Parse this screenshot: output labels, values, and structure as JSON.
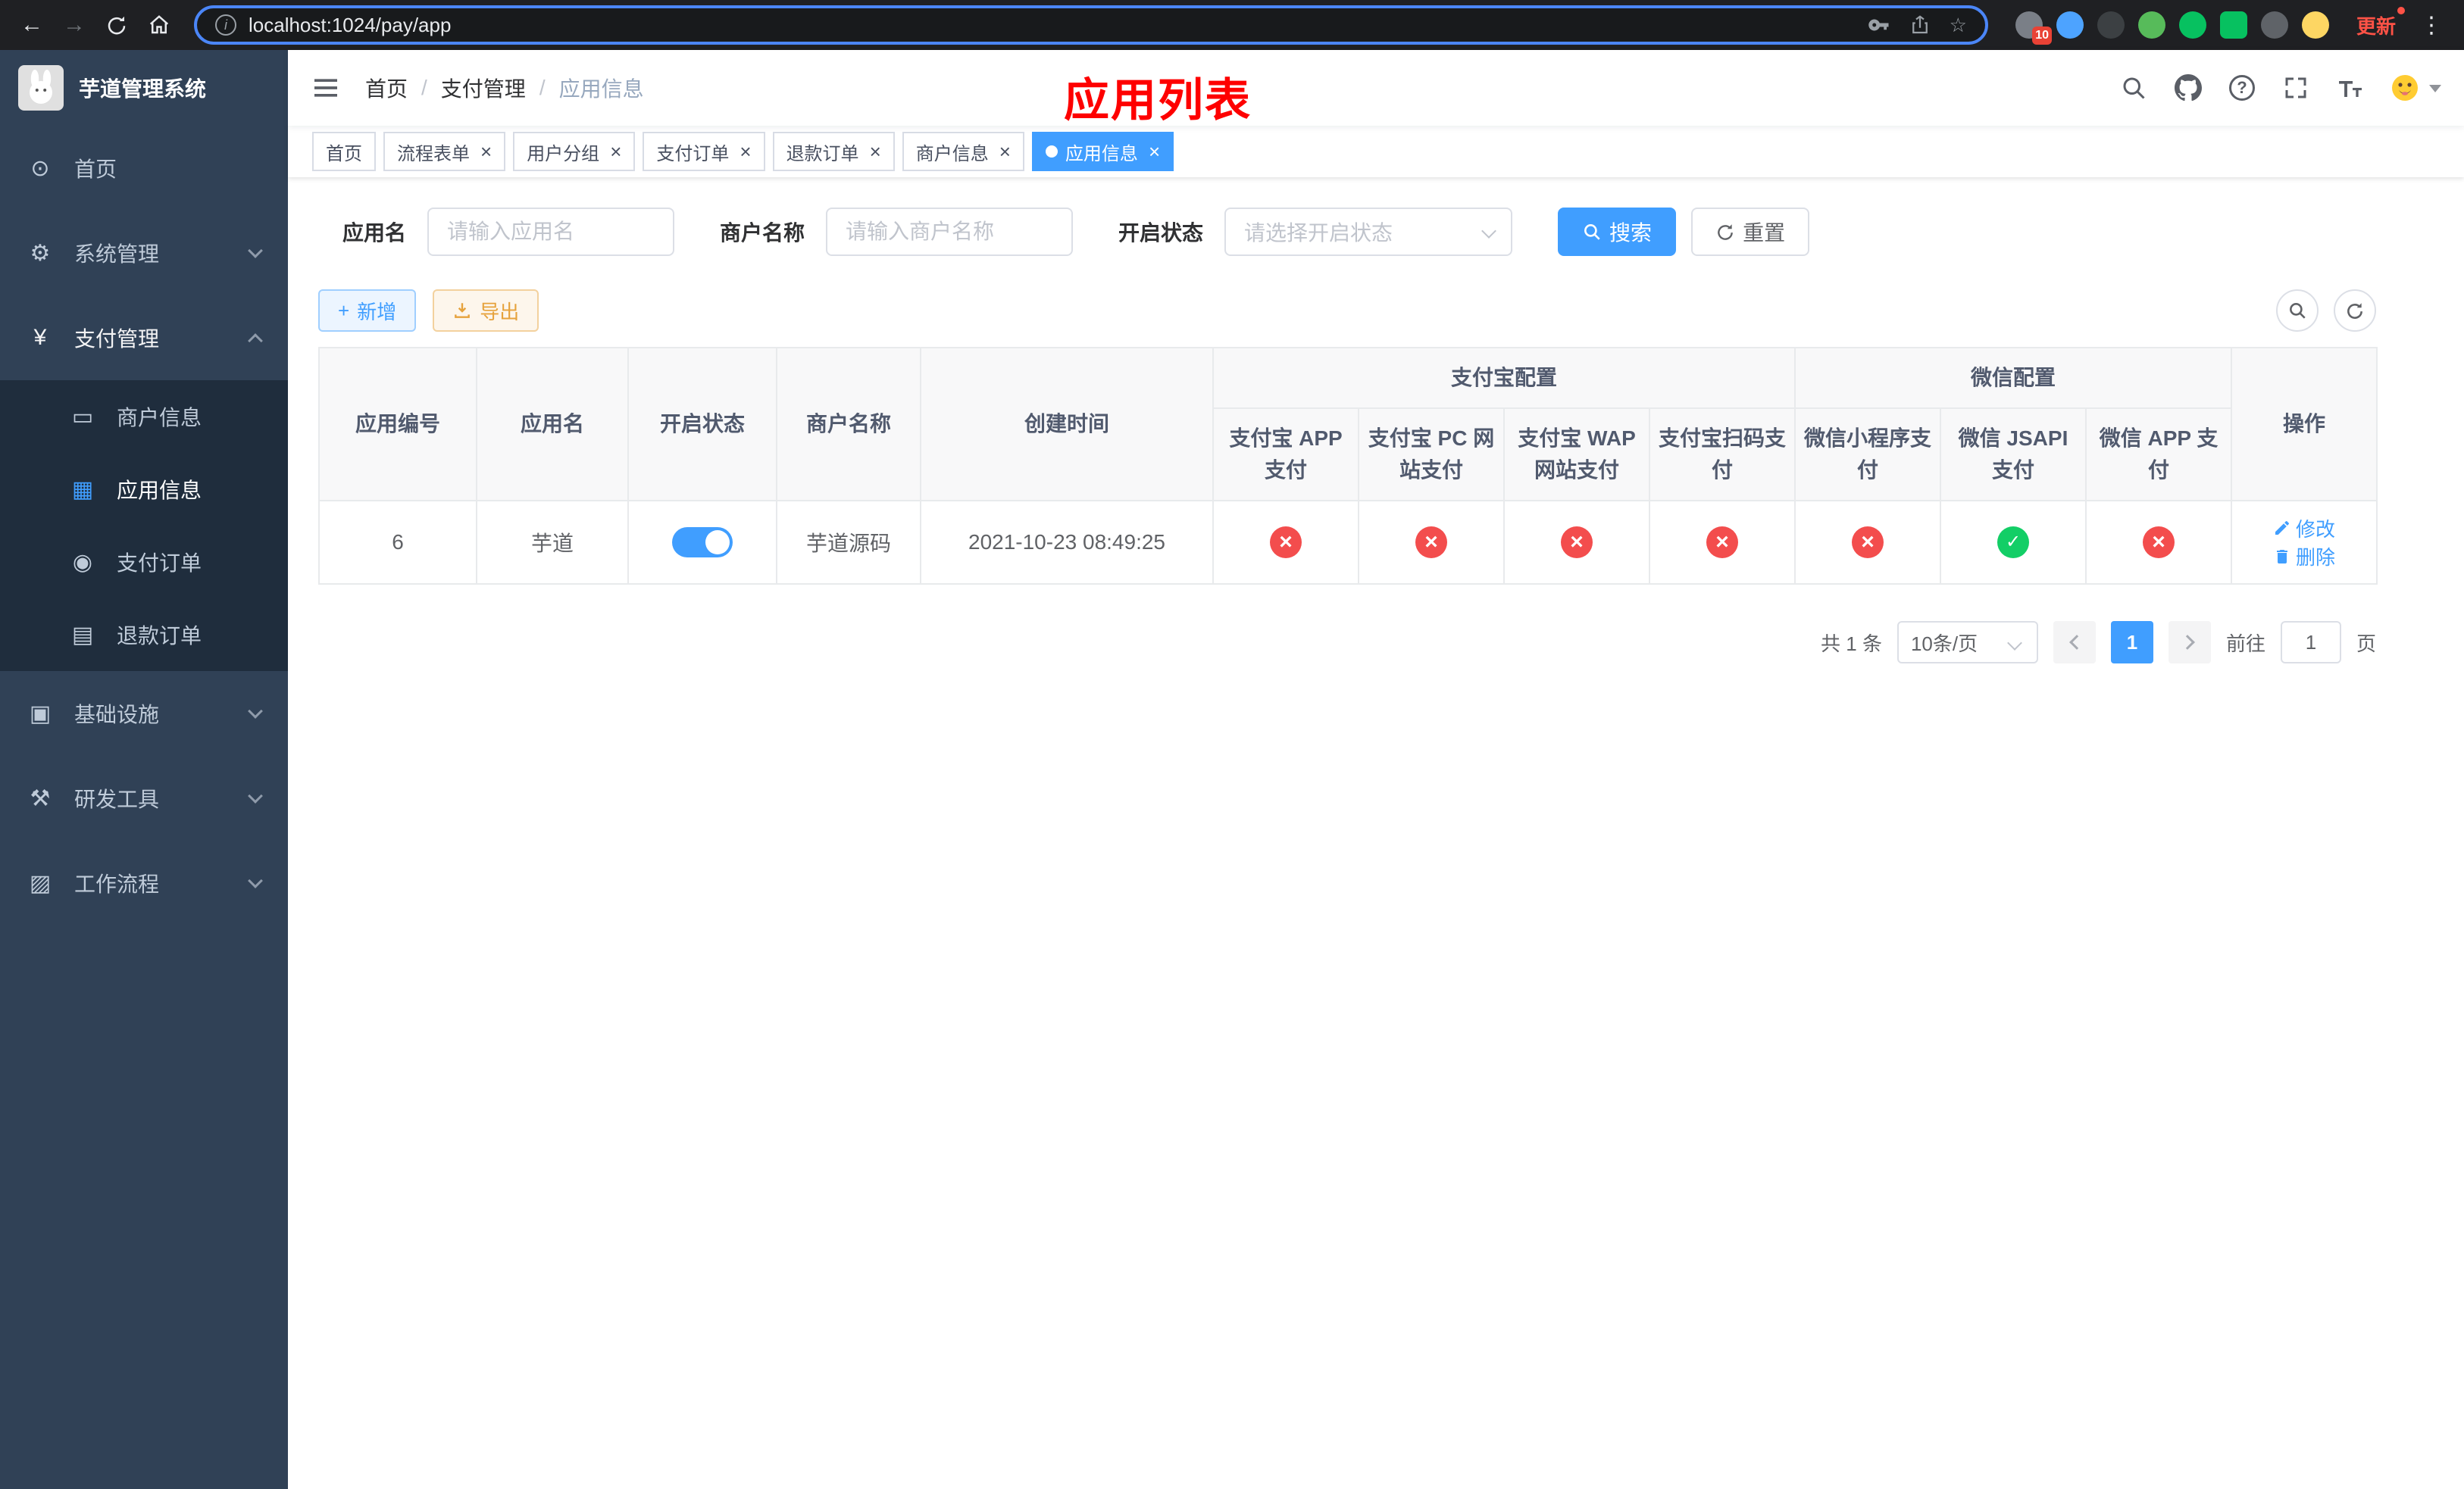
{
  "colors": {
    "primary": "#409eff",
    "success": "#13ce66",
    "danger": "#f34d4d",
    "warning": "#e6a23c",
    "sidebar_bg": "#304156",
    "submenu_bg": "#1f2d3d",
    "annotation": "#fe0000",
    "chrome_bg": "#1f2023",
    "chrome_update": "#ff5246"
  },
  "icons": {
    "back": "←",
    "forward": "→",
    "info": "i",
    "star": "☆",
    "menu_dots": "⋮",
    "close": "×",
    "dashboard": "⊙",
    "gear": "⚙",
    "yen": "¥",
    "merchant": "▭",
    "app": "▦",
    "order": "◉",
    "refund": "▤",
    "infra": "▣",
    "devtool": "⚒",
    "workflow": "▨",
    "plus": "+"
  },
  "browser": {
    "url": "localhost:1024/pay/app",
    "update_label": "更新",
    "extension_badge": "10"
  },
  "sidebar": {
    "logo_title": "芋道管理系统",
    "items": [
      {
        "label": "首页"
      },
      {
        "label": "系统管理"
      },
      {
        "label": "支付管理"
      },
      {
        "label": "基础设施"
      },
      {
        "label": "研发工具"
      },
      {
        "label": "工作流程"
      }
    ],
    "payment_children": [
      {
        "label": "商户信息"
      },
      {
        "label": "应用信息"
      },
      {
        "label": "支付订单"
      },
      {
        "label": "退款订单"
      }
    ]
  },
  "navbar": {
    "breadcrumb": [
      "首页",
      "支付管理",
      "应用信息"
    ],
    "separator": "/",
    "annotation": "应用列表"
  },
  "tags": [
    {
      "label": "首页"
    },
    {
      "label": "流程表单"
    },
    {
      "label": "用户分组"
    },
    {
      "label": "支付订单"
    },
    {
      "label": "退款订单"
    },
    {
      "label": "商户信息"
    },
    {
      "label": "应用信息"
    }
  ],
  "filters": {
    "app_name_label": "应用名",
    "app_name_placeholder": "请输入应用名",
    "merchant_label": "商户名称",
    "merchant_placeholder": "请输入商户名称",
    "status_label": "开启状态",
    "status_placeholder": "请选择开启状态",
    "search_label": "搜索",
    "reset_label": "重置"
  },
  "toolbar": {
    "add_label": "新增",
    "export_label": "导出"
  },
  "table": {
    "headers": {
      "app_id": "应用编号",
      "app_name": "应用名",
      "status": "开启状态",
      "merchant": "商户名称",
      "create_time": "创建时间",
      "alipay_group": "支付宝配置",
      "wechat_group": "微信配置",
      "actions": "操作",
      "alipay_app": "支付宝 APP 支付",
      "alipay_pc": "支付宝 PC 网站支付",
      "alipay_wap": "支付宝 WAP 网站支付",
      "alipay_qr": "支付宝扫码支付",
      "wx_lite": "微信小程序支付",
      "wx_jsapi": "微信 JSAPI 支付",
      "wx_app": "微信 APP 支付"
    },
    "row": {
      "id": "6",
      "name": "芋道",
      "status": "on",
      "merchant": "芋道源码",
      "create_time": "2021-10-23 08:49:25",
      "configs": [
        "fail",
        "fail",
        "fail",
        "fail",
        "fail",
        "success",
        "fail"
      ],
      "edit_label": "修改",
      "delete_label": "删除"
    }
  },
  "pagination": {
    "total_text": "共 1 条",
    "page_size": "10条/页",
    "current_page": "1",
    "goto_label": "前往",
    "goto_value": "1",
    "unit_label": "页"
  }
}
